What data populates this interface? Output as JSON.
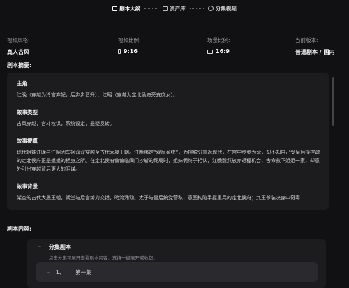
{
  "stepper": {
    "steps": [
      {
        "label": "剧本大纲",
        "icon": "book-icon"
      },
      {
        "label": "资产库",
        "icon": "folder-icon"
      },
      {
        "label": "分集视频",
        "icon": "play-circle-icon"
      }
    ]
  },
  "meta": {
    "style": {
      "label": "视频风格:",
      "value": "真人古风"
    },
    "ratio": {
      "label": "视频比例:",
      "value": "9:16"
    },
    "scene_ratio": {
      "label": "场景比例:",
      "value": "16:9"
    },
    "version": {
      "label": "当前版本:",
      "value": "普通剧本 / 国内"
    }
  },
  "summary": {
    "title": "剧本摘要:",
    "blocks": [
      {
        "heading": "主角",
        "text": "江晚（穿越为冷宫弃妃，后步步晋升）、江昭（穿越为定北侯府旁支庶女）。"
      },
      {
        "heading": "故事类型",
        "text": "古风穿越，宫斗权谋，系统设定，悬疑反转。"
      },
      {
        "heading": "故事梗概",
        "text": "现代姐妹江晚与江昭因车祸双双穿越至古代大晟王朝。江晚绑定“观局系统”，为摆脱分重返现代，在宫中步步为营，却不知自己受皇后操控疏的定北侯府正是姐姐的栖身之所。在定北侯府偏偏临阖门抄斩的死局时，姐妹俩终于相认，江晚毅然放弃返程机会，舍命救下姐姐一家，却意外引出穿越背后更大的阴谋。"
      },
      {
        "heading": "故事背景",
        "text": "架空的古代大晟王朝，朝堂与后宫势力交错，暗流涌动。太子与皇后统党营私，意图构陷手握重兵的定北侯府；九王爷装决身中奇毒..."
      }
    ]
  },
  "content": {
    "title": "剧本内容:",
    "episodes_group": {
      "title": "分集剧本",
      "desc": "点击分集可展开查看剧本内容，支持一键展开或收起。"
    },
    "episodes": [
      {
        "num": "1、",
        "name": "第一集"
      }
    ]
  }
}
